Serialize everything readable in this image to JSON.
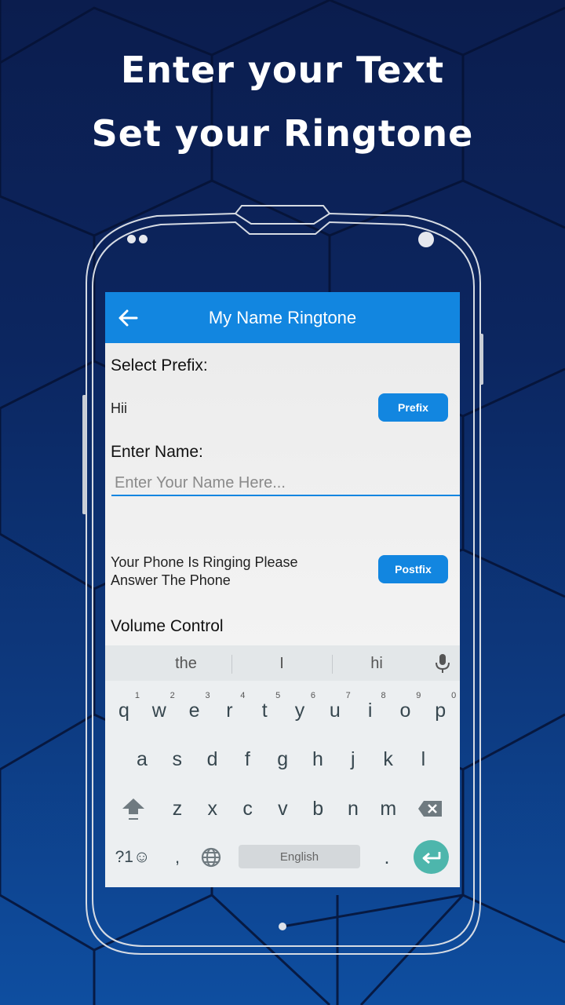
{
  "promo": {
    "line1": "Enter your Text",
    "line2": "Set your Ringtone"
  },
  "colors": {
    "primary": "#1286e0",
    "enter_key": "#4db6ac",
    "background": "#0c2660"
  },
  "app": {
    "title": "My Name Ringtone",
    "back_icon": "arrow-left-icon"
  },
  "form": {
    "prefix_label": "Select Prefix:",
    "prefix_value": "Hii",
    "prefix_button": "Prefix",
    "name_label": "Enter Name:",
    "name_placeholder": "Enter Your Name Here...",
    "name_value": "",
    "postfix_value_line1": "Your Phone Is Ringing Please",
    "postfix_value_line2": "Answer The Phone",
    "postfix_button": "Postfix",
    "volume_label": "Volume Control"
  },
  "keyboard": {
    "suggestions": [
      "the",
      "I",
      "hi"
    ],
    "row1": [
      "q",
      "w",
      "e",
      "r",
      "t",
      "y",
      "u",
      "i",
      "o",
      "p"
    ],
    "row1_numbers": [
      "1",
      "2",
      "3",
      "4",
      "5",
      "6",
      "7",
      "8",
      "9",
      "0"
    ],
    "row2": [
      "a",
      "s",
      "d",
      "f",
      "g",
      "h",
      "j",
      "k",
      "l"
    ],
    "row3": [
      "z",
      "x",
      "c",
      "v",
      "b",
      "n",
      "m"
    ],
    "symbols_key": "?1☺",
    "comma_key": ",",
    "period_key": ".",
    "space_label": "English",
    "icons": [
      "mic-icon",
      "shift-icon",
      "backspace-icon",
      "globe-icon",
      "enter-icon"
    ]
  }
}
